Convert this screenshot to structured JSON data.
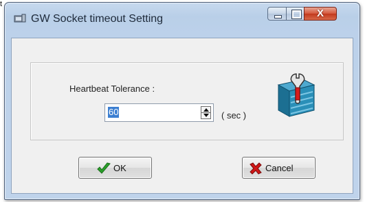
{
  "stray_text": "t",
  "window": {
    "title": "GW Socket timeout Setting",
    "controls": {
      "close_glyph": "X"
    }
  },
  "form": {
    "label": "Heartbeat Tolerance :",
    "value": "60",
    "unit": "( sec )"
  },
  "buttons": {
    "ok": "OK",
    "cancel": "Cancel"
  },
  "icons": {
    "app": "app-icon",
    "settings": "wrench-icon",
    "ok": "check-icon",
    "cancel": "x-icon"
  },
  "colors": {
    "title_bar": "#bcd1ea",
    "close_button": "#c2391d",
    "selection": "#3c7fd1",
    "check": "#2aa12a",
    "cancel_x": "#d01818",
    "tool_icon_base": "#1f7da3"
  }
}
